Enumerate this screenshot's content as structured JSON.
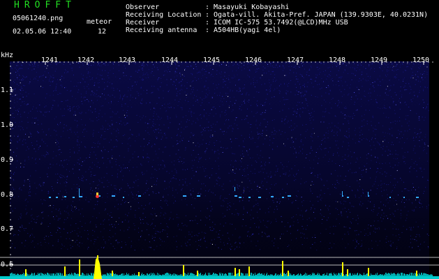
{
  "header": {
    "app_title": "HROFFT",
    "file_name": "05061240.png",
    "datetime": "02.05.06 12:40",
    "meteor_label": "meteor",
    "meteor_count": "12"
  },
  "info": [
    {
      "key": "Observer",
      "value": ": Masayuki Kobayashi"
    },
    {
      "key": "Receiving Location",
      "value": ": Ogata-vill. Akita-Pref. JAPAN (139.9303E, 40.0231N)"
    },
    {
      "key": "Receiver",
      "value": ": ICOM IC-575 53.7492(@LCD)MHz USB"
    },
    {
      "key": "Receiving antenna",
      "value": ": A504HB(yagi 4el)"
    }
  ],
  "axis": {
    "y_unit": "kHz",
    "y_ticks": [
      "1.1",
      "1.0",
      "0.9",
      "0.8",
      "0.7",
      "0.6"
    ],
    "x_ticks": [
      "1241",
      "1242",
      "1243",
      "1244",
      "1245",
      "1246",
      "1247",
      "1248",
      "1249",
      "1250"
    ]
  },
  "colors": {
    "background": "#000000",
    "noise": "#1a1a8a",
    "echo": "#33aaff",
    "peak": "#ffff00",
    "baseline": "#00cccc",
    "header_green": "#22dd22"
  }
}
